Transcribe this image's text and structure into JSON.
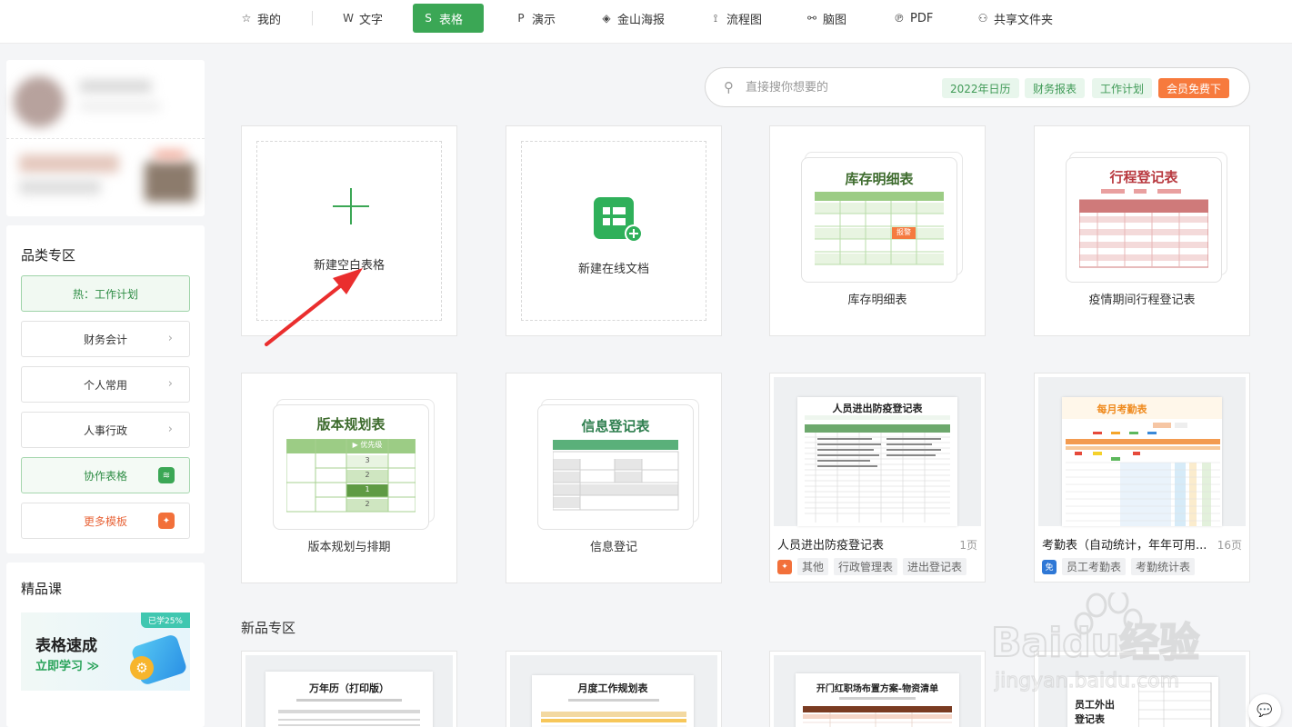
{
  "nav": {
    "items": [
      {
        "label": "我的",
        "icon": "star-icon",
        "glyph": "☆"
      },
      {
        "label": "文字",
        "icon": "writer-icon",
        "glyph": "W"
      },
      {
        "label": "表格",
        "icon": "sheet-icon",
        "glyph": "S"
      },
      {
        "label": "演示",
        "icon": "slides-icon",
        "glyph": "P"
      },
      {
        "label": "金山海报",
        "icon": "poster-icon",
        "glyph": "◈"
      },
      {
        "label": "流程图",
        "icon": "flowchart-icon",
        "glyph": "⟟"
      },
      {
        "label": "脑图",
        "icon": "mindmap-icon",
        "glyph": "⚯"
      },
      {
        "label": "PDF",
        "icon": "pdf-icon",
        "glyph": "℗"
      },
      {
        "label": "共享文件夹",
        "icon": "share-folder-icon",
        "glyph": "⚇"
      }
    ],
    "active_index": 2,
    "accent": "#3ba755"
  },
  "sidebar": {
    "category_title": "品类专区",
    "categories": [
      {
        "label": "热：工作计划"
      },
      {
        "label": "财务会计"
      },
      {
        "label": "个人常用"
      },
      {
        "label": "人事行政"
      },
      {
        "label": "协作表格"
      },
      {
        "label": "更多模板"
      }
    ],
    "course_section_title": "精品课",
    "course": {
      "title": "表格速成",
      "link": "立即学习 ≫",
      "badge": "已学25%"
    }
  },
  "search": {
    "placeholder": "直接搜你想要的",
    "tags": [
      "2022年日历",
      "财务报表",
      "工作计划",
      "会员免费下"
    ]
  },
  "cards": {
    "new_blank": "新建空白表格",
    "new_online": "新建在线文档",
    "inventory": {
      "label": "库存明细表",
      "thumb_title": "库存明细表",
      "alert": "报警"
    },
    "itinerary": {
      "label": "疫情期间行程登记表",
      "thumb_title": "行程登记表"
    },
    "version": {
      "label": "版本规划与排期",
      "thumb_title": "版本规划表",
      "priority_header": "优先级",
      "priorities": [
        "3",
        "2",
        "1",
        "2"
      ]
    },
    "info": {
      "label": "信息登记",
      "thumb_title": "信息登记表"
    },
    "epidemic": {
      "name": "人员进出防疫登记表",
      "pages": "1页",
      "thumb_title": "人员进出防疫登记表",
      "tags": [
        "其他",
        "行政管理表",
        "进出登记表"
      ]
    },
    "attendance": {
      "name": "考勤表（自动统计，年年可用...",
      "pages": "16页",
      "thumb_title": "每月考勤表",
      "source_badge": "免",
      "tags": [
        "员工考勤表",
        "考勤统计表"
      ]
    }
  },
  "new_section": {
    "title": "新品专区",
    "items": [
      {
        "thumb_title": "万年历（打印版）"
      },
      {
        "thumb_title": "月度工作规划表"
      },
      {
        "thumb_title": "开门红职场布置方案-物资清单"
      },
      {
        "thumb_title": "员工外出登记表"
      }
    ]
  },
  "watermark": {
    "text": "Baidu经验",
    "sub": "jingyan.baidu.com"
  }
}
